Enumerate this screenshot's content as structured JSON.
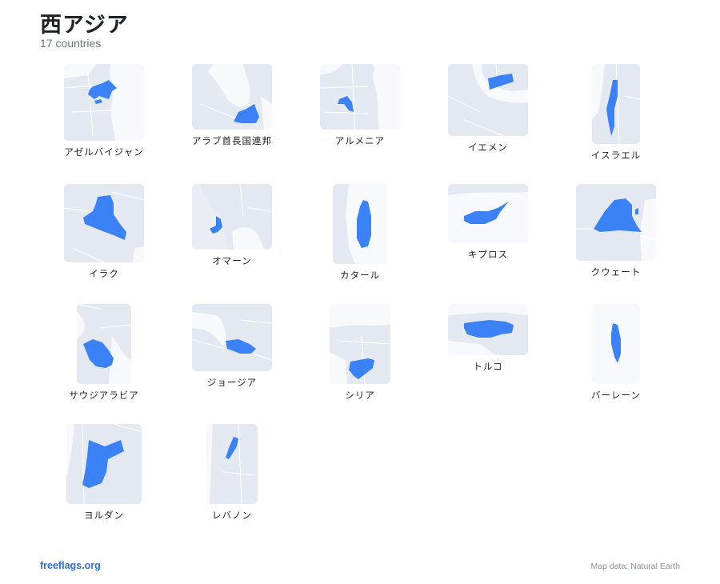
{
  "header": {
    "title": "西アジア",
    "subtitle": "17 countries"
  },
  "colors": {
    "highlight": "#3b82f6",
    "land": "#e4e8f0",
    "sea": "#f7f9fc",
    "border": "#ffffff"
  },
  "countries": [
    {
      "name": "アゼルバイジャン",
      "icon": "azerbaijan-map"
    },
    {
      "name": "アラブ首長国連邦",
      "icon": "uae-map"
    },
    {
      "name": "アルメニア",
      "icon": "armenia-map"
    },
    {
      "name": "イエメン",
      "icon": "yemen-map"
    },
    {
      "name": "イスラエル",
      "icon": "israel-map"
    },
    {
      "name": "イラク",
      "icon": "iraq-map"
    },
    {
      "name": "オマーン",
      "icon": "oman-map"
    },
    {
      "name": "カタール",
      "icon": "qatar-map"
    },
    {
      "name": "キプロス",
      "icon": "cyprus-map"
    },
    {
      "name": "クウェート",
      "icon": "kuwait-map"
    },
    {
      "name": "サウジアラビア",
      "icon": "saudi-arabia-map"
    },
    {
      "name": "ジョージア",
      "icon": "georgia-map"
    },
    {
      "name": "シリア",
      "icon": "syria-map"
    },
    {
      "name": "トルコ",
      "icon": "turkey-map"
    },
    {
      "name": "バーレーン",
      "icon": "bahrain-map"
    },
    {
      "name": "ヨルダン",
      "icon": "jordan-map"
    },
    {
      "name": "レバノン",
      "icon": "lebanon-map"
    }
  ],
  "footer": {
    "site": "freeflags.org",
    "credit": "Map data: Natural Earth"
  }
}
